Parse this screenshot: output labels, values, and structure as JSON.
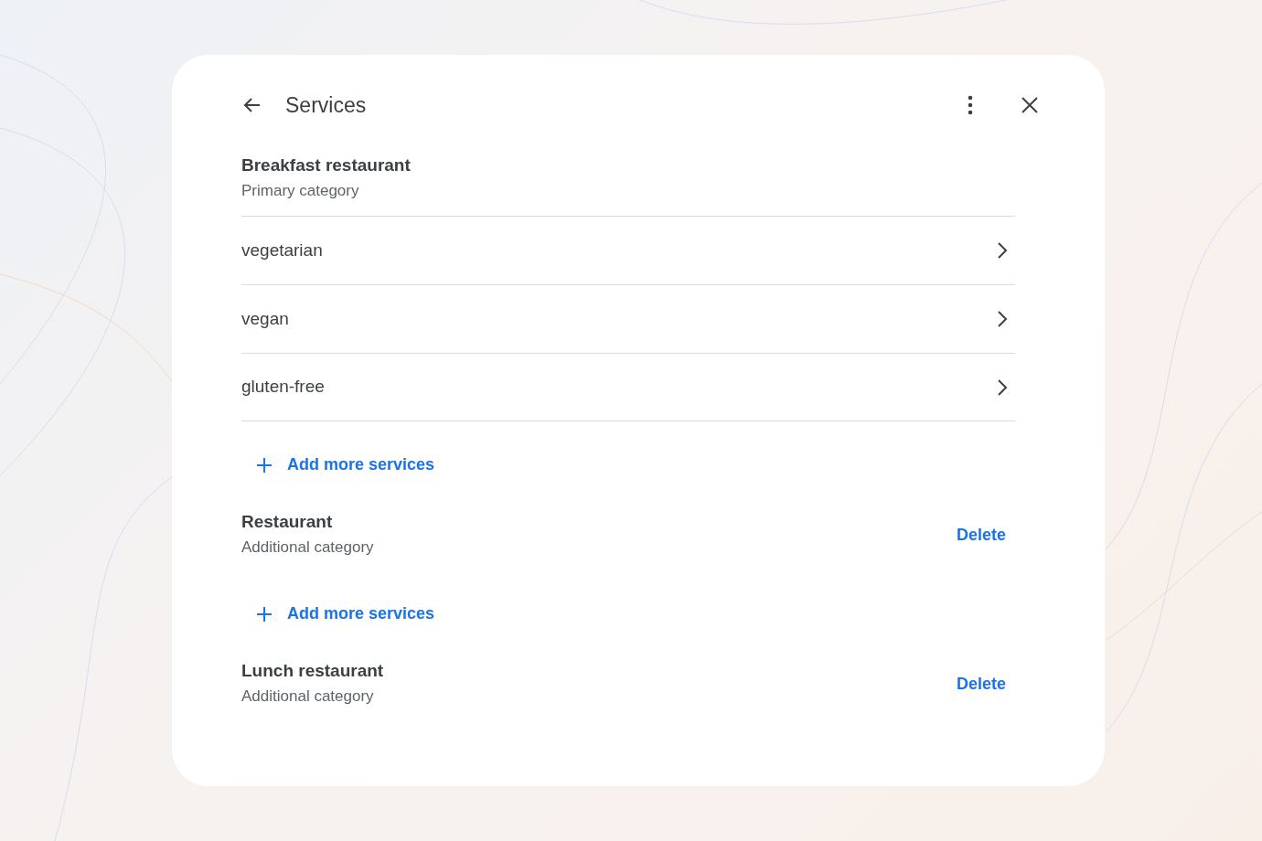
{
  "header": {
    "title": "Services"
  },
  "categories": [
    {
      "name": "Breakfast restaurant",
      "type": "Primary category",
      "services": [
        "vegetarian",
        "vegan",
        "gluten-free"
      ],
      "add_label": "Add more services"
    },
    {
      "name": "Restaurant",
      "type": "Additional category",
      "delete_label": "Delete",
      "add_label": "Add more services"
    },
    {
      "name": "Lunch restaurant",
      "type": "Additional category",
      "delete_label": "Delete"
    }
  ]
}
